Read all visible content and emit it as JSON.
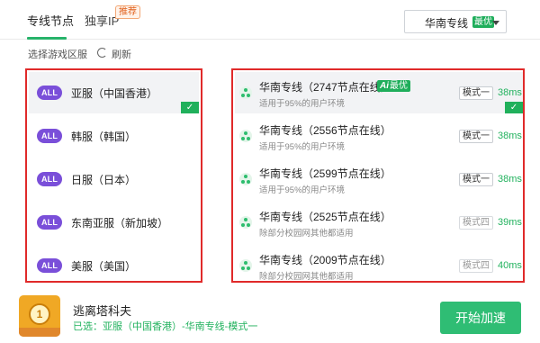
{
  "tabs": [
    {
      "label": "专线节点"
    },
    {
      "label": "独享IP",
      "badge": "推荐"
    }
  ],
  "region_select": {
    "label": "华南专线",
    "badge": "最优"
  },
  "subheader": {
    "label": "选择游戏区服",
    "refresh_label": "刷新"
  },
  "servers": [
    {
      "badge": "ALL",
      "name": "亚服（中国香港）"
    },
    {
      "badge": "ALL",
      "name": "韩服（韩国）"
    },
    {
      "badge": "ALL",
      "name": "日服（日本）"
    },
    {
      "badge": "ALL",
      "name": "东南亚服（新加坡）"
    },
    {
      "badge": "ALL",
      "name": "美服（美国）"
    }
  ],
  "nodes": [
    {
      "title": "华南专线（2747节点在线）",
      "badge_ai": "Ai",
      "badge_text": "最优",
      "subtitle": "适用于95%的用户环境",
      "mode": "模式一",
      "latency": "38ms"
    },
    {
      "title": "华南专线（2556节点在线）",
      "subtitle": "适用于95%的用户环境",
      "mode": "模式一",
      "latency": "38ms"
    },
    {
      "title": "华南专线（2599节点在线）",
      "subtitle": "适用于95%的用户环境",
      "mode": "模式一",
      "latency": "38ms"
    },
    {
      "title": "华南专线（2525节点在线）",
      "subtitle": "除部分校园网其他都适用",
      "mode": "模式四",
      "latency": "39ms"
    },
    {
      "title": "华南专线（2009节点在线）",
      "subtitle": "除部分校园网其他都适用",
      "mode": "模式四",
      "latency": "40ms"
    }
  ],
  "footer": {
    "game_title": "逃离塔科夫",
    "selected_info": "已选：亚服（中国香港）-华南专线-模式一",
    "start_button": "开始加速",
    "game_icon_glyph": "1"
  },
  "colors": {
    "accent": "#2fbd74",
    "highlight_border": "#e02a2a",
    "badge_purple": "#7a4fd9"
  }
}
